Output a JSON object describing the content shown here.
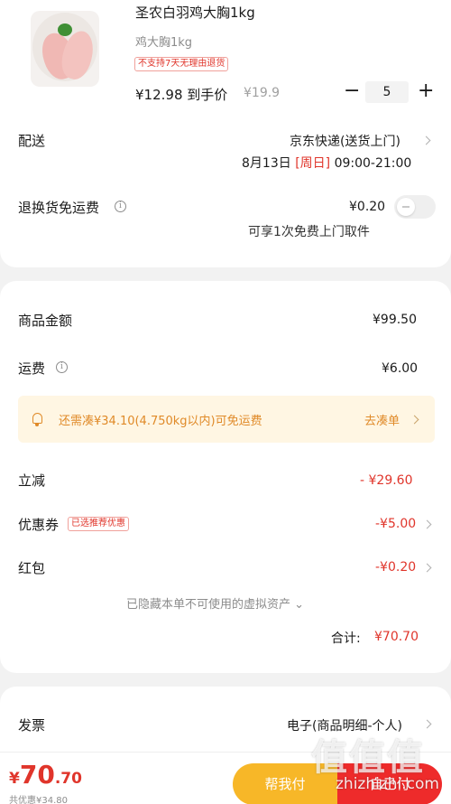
{
  "product": {
    "title": "圣农白羽鸡大胸1kg",
    "spec": "鸡大胸1kg",
    "return_tag": "不支持7天无理由退货",
    "price_prefix": "¥12.98",
    "price_suffix": "到手价",
    "original_price": "¥19.9",
    "quantity": "5",
    "minus_label": "−",
    "plus_label": "+"
  },
  "delivery": {
    "label": "配送",
    "method": "京东快递(送货上门)",
    "date": "8月13日",
    "weekday": "[周日]",
    "time": "09:00-21:00"
  },
  "return_shipping": {
    "label": "退换货免运费",
    "price": "¥0.20",
    "note": "可享1次免费上门取件",
    "enabled": false
  },
  "summary": {
    "goods_label": "商品金额",
    "goods_value": "¥99.50",
    "freight_label": "运费",
    "freight_value": "¥6.00",
    "banner_text": "还需凑¥34.10(4.750kg以内)可免运费",
    "banner_action": "去凑单",
    "discount_label": "立减",
    "discount_value": "- ¥29.60",
    "coupon_label": "优惠券",
    "coupon_tag": "已选推荐优惠",
    "coupon_value": "-¥5.00",
    "redpacket_label": "红包",
    "redpacket_value": "-¥0.20",
    "hidden_note": "已隐藏本单不可使用的虚拟资产",
    "total_label": "合计:",
    "total_value": "¥70.70"
  },
  "invoice": {
    "label": "发票",
    "value": "电子(商品明细-个人)"
  },
  "bottom": {
    "currency": "¥",
    "price_int": "70",
    "price_dec": ".70",
    "saved": "共优惠¥34.80",
    "help_button": "帮我付",
    "pay_button": "自己付"
  },
  "watermark": {
    "chars": "值值值",
    "url": "zhizhizhi.com"
  },
  "colors": {
    "accent_red": "#e0352b",
    "banner_orange": "#e08a28",
    "help_yellow": "#f7b728",
    "pay_red": "#ee2b2b"
  }
}
